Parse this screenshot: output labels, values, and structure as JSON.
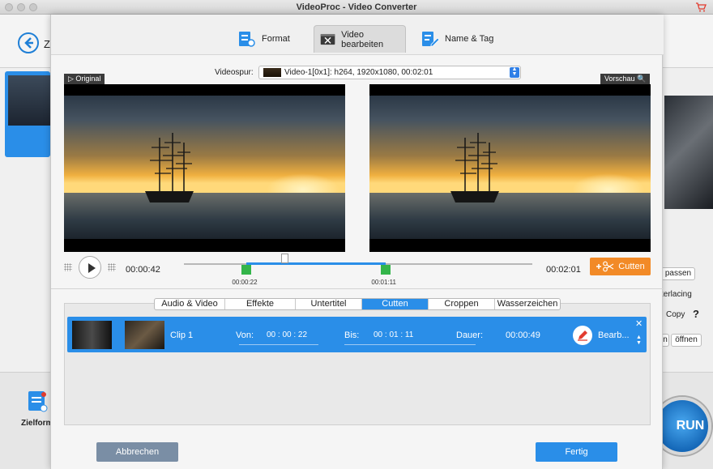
{
  "window": {
    "title": "VideoProc - Video Converter"
  },
  "background": {
    "header_partial": "Z",
    "right_panel": {
      "anpassen": "passen",
      "interlacing": "terlacing",
      "copy": "Copy",
      "help": "?",
      "oeffnen": "öffnen",
      "n": "n"
    },
    "zielformat": "Zielform",
    "run_label": "RUN"
  },
  "tabs": [
    {
      "label": "Format",
      "icon": "format-icon",
      "active": false
    },
    {
      "label": "Video bearbeiten",
      "icon": "video-edit-icon",
      "active": true
    },
    {
      "label": "Name & Tag",
      "icon": "name-tag-icon",
      "active": false
    }
  ],
  "videospur": {
    "label": "Videospur:",
    "value": "Video-1[0x1]: h264, 1920x1080, 00:02:01"
  },
  "preview": {
    "original_label": "Original",
    "vorschau_label": "Vorschau"
  },
  "timeline": {
    "current_time": "00:00:42",
    "total_time": "00:02:01",
    "start_marker": "00:00:22",
    "end_marker": "00:01:11",
    "start_fraction": 0.18,
    "end_fraction": 0.58,
    "playhead_fraction": 0.29
  },
  "cutten_button": "Cutten",
  "subtabs": [
    {
      "label": "Audio & Video",
      "active": false
    },
    {
      "label": "Effekte",
      "active": false
    },
    {
      "label": "Untertitel",
      "active": false
    },
    {
      "label": "Cutten",
      "active": true
    },
    {
      "label": "Croppen",
      "active": false
    },
    {
      "label": "Wasserzeichen",
      "active": false
    }
  ],
  "clip": {
    "name": "Clip 1",
    "von_label": "Von:",
    "von": "00 : 00 : 22",
    "bis_label": "Bis:",
    "bis": "00 : 01 : 11",
    "dauer_label": "Dauer:",
    "dauer": "00:00:49",
    "edit_label": "Bearb..."
  },
  "buttons": {
    "abbrechen": "Abbrechen",
    "fertig": "Fertig"
  },
  "colors": {
    "accent": "#2a8ee8",
    "cutten": "#f28a27",
    "marker": "#34b54a"
  }
}
